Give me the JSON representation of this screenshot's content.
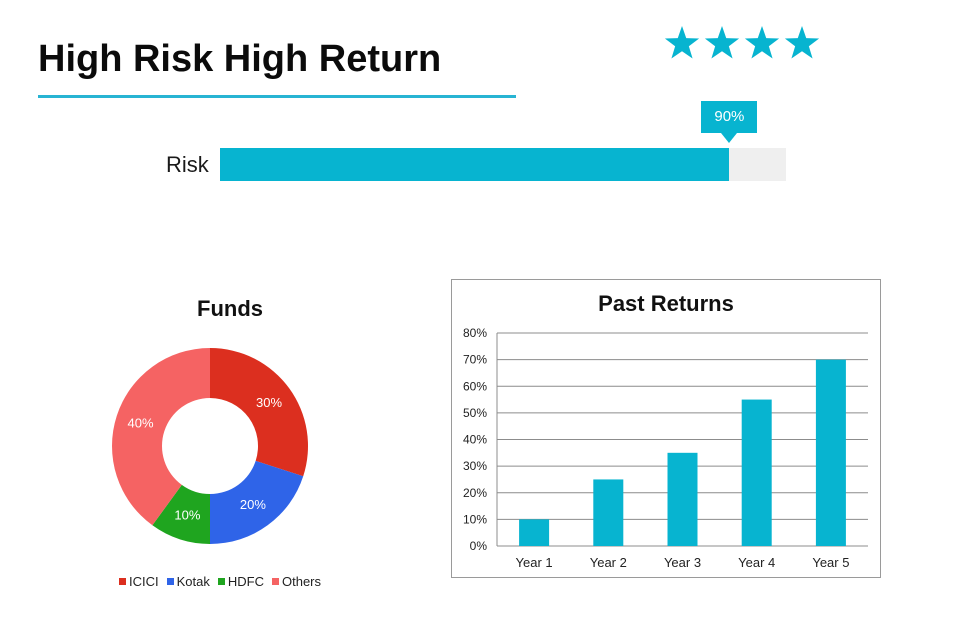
{
  "header": {
    "title": "High Risk High Return",
    "rating": {
      "stars": 4,
      "star_color": "#07b4d0",
      "icon": "star-icon"
    }
  },
  "risk": {
    "label": "Risk",
    "value": 0.9,
    "value_label": "90%",
    "fill_color": "#07b4d0",
    "track_color": "#efefef"
  },
  "chart_data": [
    {
      "type": "pie",
      "style": "donut",
      "title": "Funds",
      "categories": [
        "ICICI",
        "Kotak",
        "HDFC",
        "Others"
      ],
      "values": [
        30,
        20,
        10,
        40
      ],
      "value_labels": [
        "30%",
        "20%",
        "10%",
        "40%"
      ],
      "colors": [
        "#dc2f1f",
        "#2f64e8",
        "#1fa51f",
        "#f56363"
      ],
      "legend": "bottom"
    },
    {
      "type": "bar",
      "title": "Past Returns",
      "categories": [
        "Year 1",
        "Year 2",
        "Year 3",
        "Year 4",
        "Year 5"
      ],
      "values": [
        10,
        25,
        35,
        55,
        70
      ],
      "ylim": [
        0,
        80
      ],
      "y_ticks": [
        "0%",
        "10%",
        "20%",
        "30%",
        "40%",
        "50%",
        "60%",
        "70%",
        "80%"
      ],
      "grid": true,
      "bar_color": "#07b4d0",
      "xlabel": "",
      "ylabel": ""
    }
  ]
}
